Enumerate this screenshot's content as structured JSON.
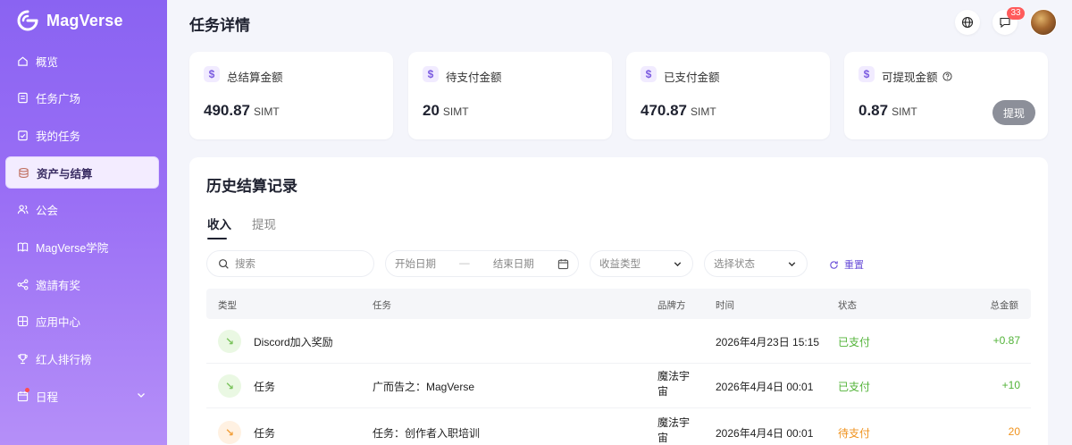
{
  "brand": {
    "name": "MagVerse"
  },
  "sidebar": {
    "items": [
      {
        "label": "概览",
        "icon": "home-icon"
      },
      {
        "label": "任务广场",
        "icon": "task-square-icon"
      },
      {
        "label": "我的任务",
        "icon": "my-task-icon"
      },
      {
        "label": "资产与结算",
        "icon": "database-icon",
        "active": true
      },
      {
        "label": "公会",
        "icon": "users-icon"
      },
      {
        "label": "MagVerse学院",
        "icon": "book-icon"
      },
      {
        "label": "邀請有奖",
        "icon": "share-icon"
      },
      {
        "label": "应用中心",
        "icon": "grid-icon"
      },
      {
        "label": "红人排行榜",
        "icon": "trophy-icon"
      },
      {
        "label": "日程",
        "icon": "calendar-icon"
      }
    ]
  },
  "header": {
    "title": "任务详情",
    "notification_count": "33"
  },
  "cards": [
    {
      "label": "总结算金额",
      "value": "490.87",
      "unit": "SIMT"
    },
    {
      "label": "待支付金额",
      "value": "20",
      "unit": "SIMT"
    },
    {
      "label": "已支付金额",
      "value": "470.87",
      "unit": "SIMT"
    },
    {
      "label": "可提现金额",
      "value": "0.87",
      "unit": "SIMT",
      "button": "提现"
    }
  ],
  "records": {
    "title": "历史结算记录",
    "tabs": [
      "收入",
      "提现"
    ],
    "filters": {
      "search_placeholder": "搜索",
      "start_date": "开始日期",
      "date_sep": "—",
      "end_date": "结束日期",
      "type": "收益类型",
      "status": "选择状态",
      "reset": "重置"
    },
    "columns": [
      "类型",
      "任务",
      "品牌方",
      "时间",
      "状态",
      "总金额"
    ],
    "rows": [
      {
        "type": "Discord加入奖励",
        "task": "",
        "brand": "",
        "time": "2026年4月23日 15:15",
        "status": "已支付",
        "amount": "+0.87",
        "status_color": "#52b338"
      },
      {
        "type": "任务",
        "task": "广而告之：MagVerse",
        "brand": "魔法宇宙",
        "time": "2026年4月4日 00:01",
        "status": "已支付",
        "amount": "+10",
        "status_color": "#52b338"
      },
      {
        "type": "任务",
        "task": "任务：创作者入职培训",
        "brand": "魔法宇宙",
        "time": "2026年4月4日 00:01",
        "status": "待支付",
        "amount": "20",
        "status_color": "#f0921c"
      }
    ]
  }
}
